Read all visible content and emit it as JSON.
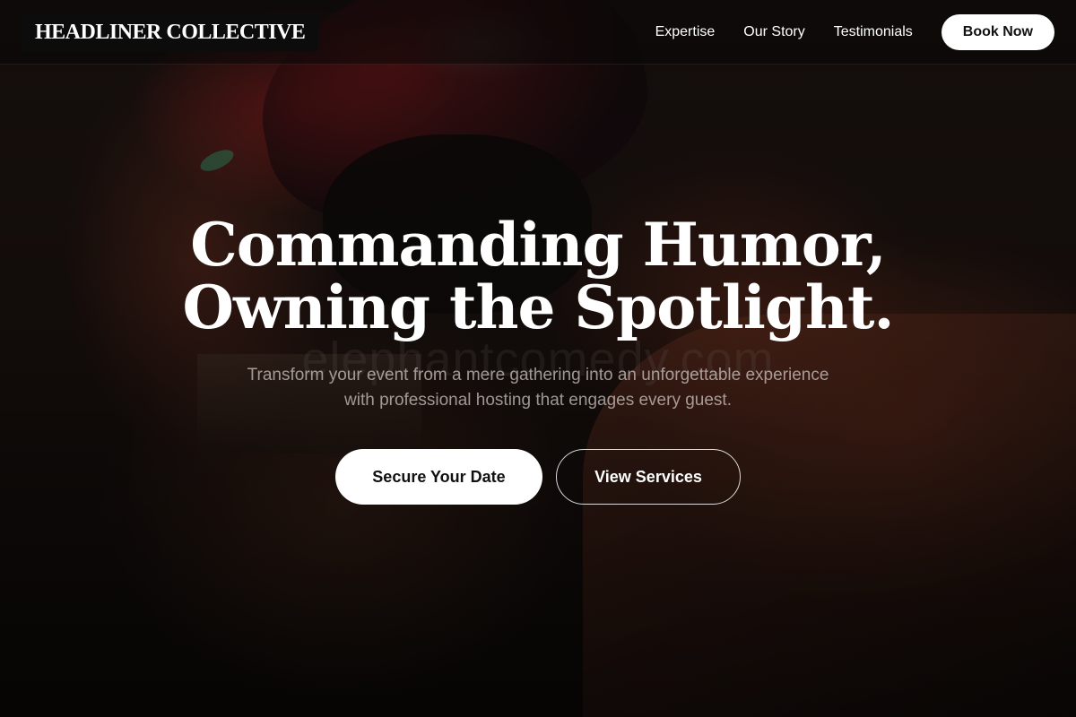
{
  "brand": {
    "name": "HEADLINER COLLECTIVE"
  },
  "nav": {
    "links": [
      "Expertise",
      "Our Story",
      "Testimonials"
    ],
    "cta_label": "Book Now"
  },
  "hero": {
    "title_line1": "Commanding Humor,",
    "title_line2": "Owning the Spotlight.",
    "subtitle": "Transform your event from a mere gathering into an unforgettable experience with professional hosting that engages every guest.",
    "primary_cta": "Secure Your Date",
    "secondary_cta": "View Services",
    "watermark": "elephantcomedy.com"
  },
  "colors": {
    "background": "#0b0807",
    "button_fill": "#ffffff",
    "button_text": "#111111"
  }
}
